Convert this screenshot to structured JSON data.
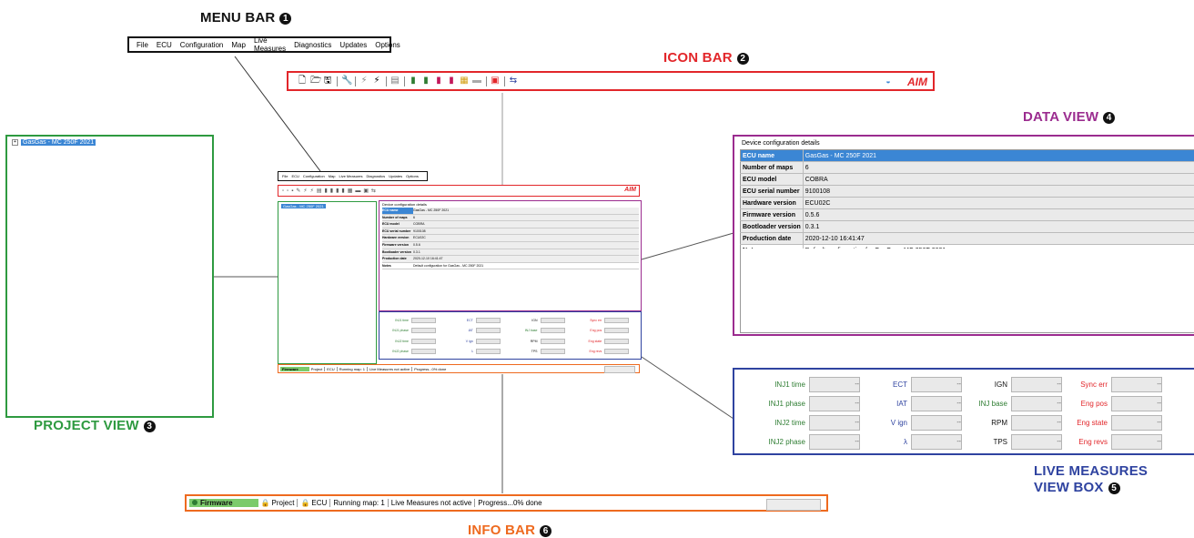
{
  "callouts": {
    "menu_bar": "MENU BAR",
    "icon_bar": "ICON BAR",
    "project_view": "PROJECT VIEW",
    "data_view": "DATA VIEW",
    "live_measures_1": "LIVE MEASURES",
    "live_measures_2": "VIEW BOX",
    "info_bar": "INFO BAR",
    "num_1": "1",
    "num_2": "2",
    "num_3": "3",
    "num_4": "4",
    "num_5": "5",
    "num_6": "6"
  },
  "menu": [
    "File",
    "ECU",
    "Configuration",
    "Map",
    "Live Measures",
    "Diagnostics",
    "Updates",
    "Options"
  ],
  "project": {
    "item": "GasGas - MC 250F 2021"
  },
  "data_view": {
    "title": "Device configuration details",
    "rows": [
      {
        "key": "ECU name",
        "value": "GasGas - MC 250F 2021"
      },
      {
        "key": "Number of maps",
        "value": "6"
      },
      {
        "key": "ECU model",
        "value": "COBRA"
      },
      {
        "key": "ECU serial number",
        "value": "9100108"
      },
      {
        "key": "Hardware version",
        "value": "ECU02C"
      },
      {
        "key": "Firmware version",
        "value": "0.5.6"
      },
      {
        "key": "Bootloader version",
        "value": "0.3.1"
      },
      {
        "key": "Production date",
        "value": "2020-12-10 16:41:47"
      },
      {
        "key": "Notes",
        "value": "Default configuration for GasGas - MC 250F 2021"
      }
    ]
  },
  "live_measures": {
    "empty_value": "--",
    "columns": [
      [
        "INJ1 time",
        "INJ1 phase",
        "INJ2 time",
        "INJ2 phase"
      ],
      [
        "ECT",
        "IAT",
        "V ign",
        "λ"
      ],
      [
        "IGN",
        "INJ base",
        "RPM",
        "TPS"
      ],
      [
        "Sync err",
        "Eng pos",
        "Eng state",
        "Eng revs"
      ]
    ]
  },
  "info_bar": {
    "firmware": "Firmware",
    "project": "Project",
    "ecu": "ECU",
    "running_map": "Running map: 1",
    "live_status": "Live Measures not active",
    "progress": "Progress...0% done"
  },
  "brand": "AIM",
  "colors": {
    "menu": "#111111",
    "icon": "#e2262a",
    "project": "#2e9a40",
    "data": "#9b2c8f",
    "live": "#2f43a0",
    "info": "#ee6a1f",
    "selection": "#3b86d4"
  }
}
